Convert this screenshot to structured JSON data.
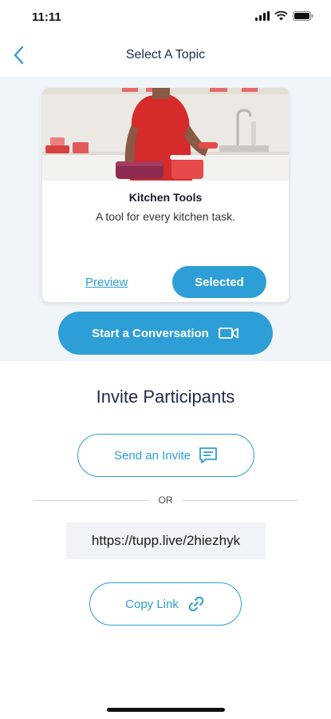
{
  "status_bar": {
    "time": "11:11"
  },
  "nav": {
    "title": "Select A Topic"
  },
  "topic_card": {
    "title": "Kitchen Tools",
    "subtitle": "A tool for every kitchen task.",
    "preview_label": "Preview",
    "selected_label": "Selected"
  },
  "start_conversation": {
    "label": "Start a Conversation"
  },
  "invite": {
    "title": "Invite Participants",
    "send_label": "Send an Invite",
    "or_label": "OR",
    "link_url": "https://tupp.live/2hiezhyk",
    "copy_label": "Copy Link"
  },
  "colors": {
    "accent": "#2e9ed6",
    "text_dark": "#1f2a4d",
    "section_bg": "#f0f5f9"
  },
  "icons": [
    "wifi-icon",
    "battery-icon",
    "signal-icon",
    "back-chevron-icon",
    "video-camera-icon",
    "chat-message-icon",
    "link-icon"
  ]
}
